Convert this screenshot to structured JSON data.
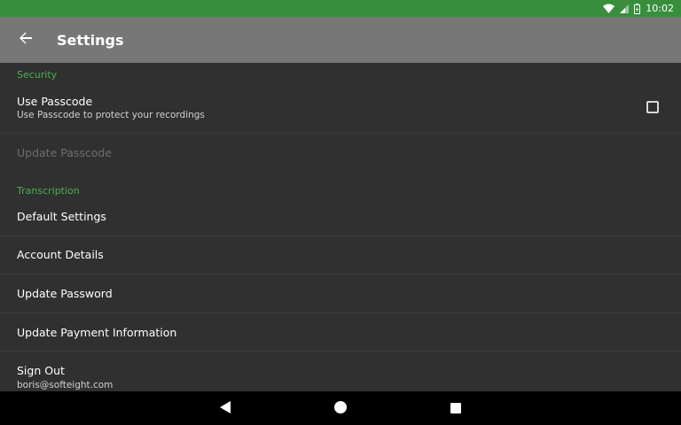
{
  "status_bar": {
    "time": "10:02"
  },
  "app_bar": {
    "title": "Settings"
  },
  "sections": {
    "security": {
      "header": "Security",
      "use_passcode": {
        "title": "Use Passcode",
        "summary": "Use Passcode to protect your recordings",
        "checked": false
      },
      "update_passcode": {
        "title": "Update Passcode"
      }
    },
    "transcription": {
      "header": "Transcription",
      "default_settings": {
        "title": "Default Settings"
      },
      "account_details": {
        "title": "Account Details"
      },
      "update_password": {
        "title": "Update Password"
      },
      "update_payment": {
        "title": "Update Payment Information"
      },
      "sign_out": {
        "title": "Sign Out",
        "summary": "boris@softeight.com"
      }
    }
  },
  "colors": {
    "accent": "#4caf50",
    "status_bar": "#388e3c",
    "app_bar": "#777777",
    "background": "#303030"
  }
}
